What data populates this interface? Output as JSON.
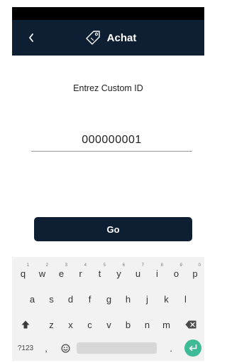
{
  "header": {
    "title": "Achat",
    "back_icon": "chevron-left-icon",
    "title_icon": "price-tag-icon",
    "background": "#0f1f33"
  },
  "form": {
    "prompt": "Entrez Custom ID",
    "custom_id_value": "000000001",
    "go_label": "Go"
  },
  "keyboard": {
    "row1": [
      {
        "key": "q",
        "hint": "1"
      },
      {
        "key": "w",
        "hint": "2"
      },
      {
        "key": "e",
        "hint": "3"
      },
      {
        "key": "r",
        "hint": "4"
      },
      {
        "key": "t",
        "hint": "5"
      },
      {
        "key": "y",
        "hint": "6"
      },
      {
        "key": "u",
        "hint": "7"
      },
      {
        "key": "i",
        "hint": "8"
      },
      {
        "key": "o",
        "hint": "9"
      },
      {
        "key": "p",
        "hint": "0"
      }
    ],
    "row2": [
      "a",
      "s",
      "d",
      "f",
      "g",
      "h",
      "j",
      "k",
      "l"
    ],
    "row3": [
      "z",
      "x",
      "c",
      "v",
      "b",
      "n",
      "m"
    ],
    "symbols_label": "?123",
    "comma_label": ",",
    "period_label": ".",
    "shift_icon": "shift-icon",
    "backspace_icon": "backspace-icon",
    "emoji_icon": "emoji-icon",
    "enter_icon": "enter-icon",
    "enter_color": "#3ebb96"
  }
}
